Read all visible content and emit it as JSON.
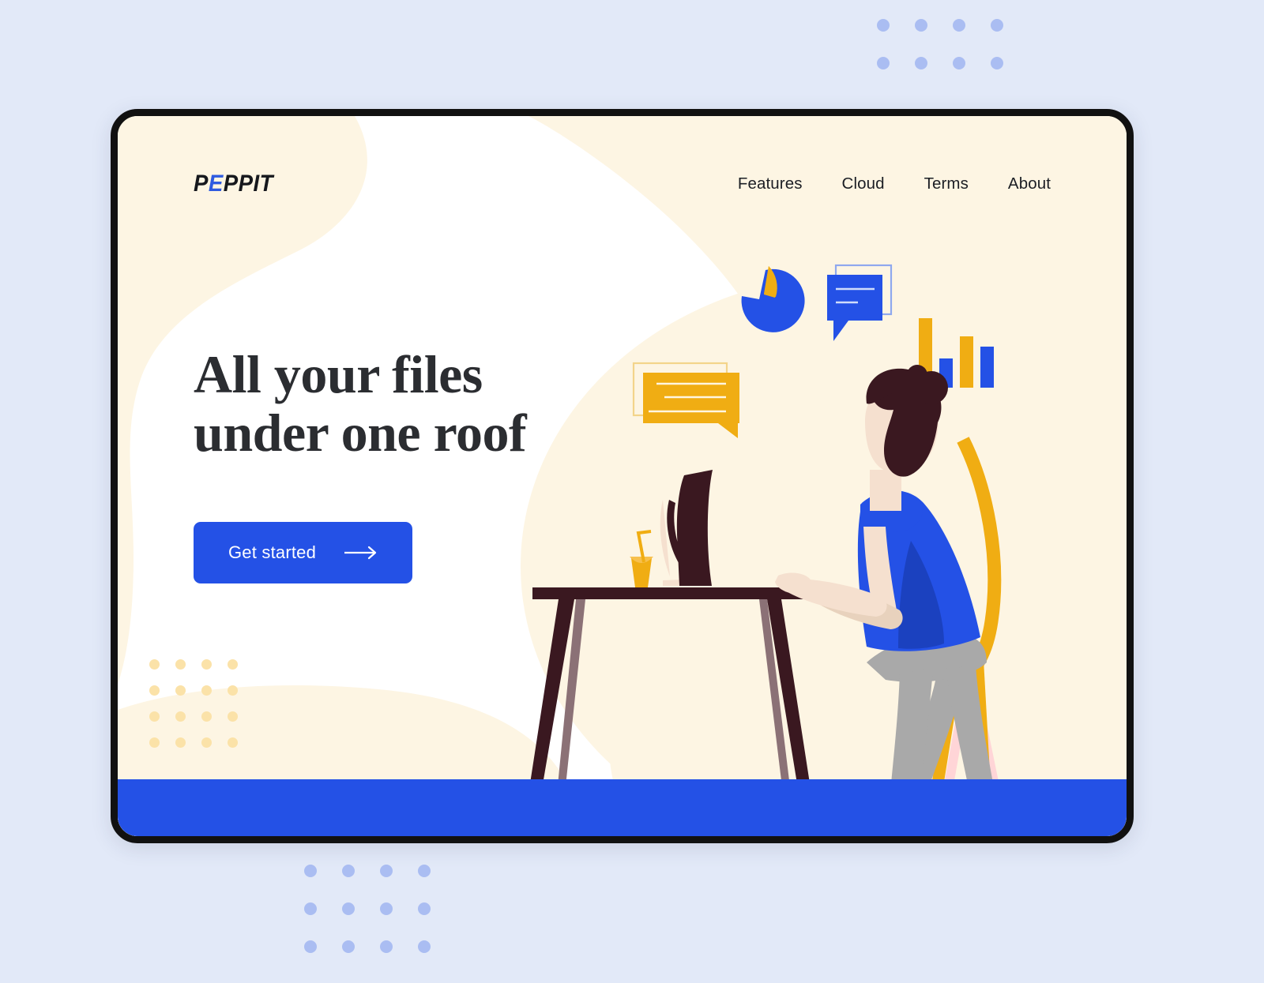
{
  "page": {
    "background_color": "#e2e9f8",
    "card_background": "#fdf5e3",
    "accent_blue": "#2451e6",
    "accent_yellow": "#f0ad13",
    "footer_color": "#2451e6",
    "frame_color": "#111111"
  },
  "brand": {
    "logo_prefix": "P",
    "logo_accent": "E",
    "logo_suffix": "PPIT",
    "logo_full": "PEPPIT",
    "accent_letter_color": "#2f5be0"
  },
  "nav": {
    "items": [
      {
        "label": "Features"
      },
      {
        "label": "Cloud"
      },
      {
        "label": "Terms"
      },
      {
        "label": "About"
      }
    ]
  },
  "hero": {
    "headline_line1": "All your files",
    "headline_line2": "under one roof",
    "cta_label": "Get started",
    "cta_icon": "arrow-right-icon",
    "cta_bg": "#2451e6",
    "cta_text_color": "#ffffff"
  },
  "decor": {
    "inner_dot_grid": {
      "rows": 4,
      "cols": 4,
      "color": "#fbe2a8",
      "spacing": 33,
      "radius": 6.5
    },
    "outer_dot_grid_top_right": {
      "rows": 3,
      "cols": 4,
      "color": "#aabdf2",
      "spacing": 48,
      "radius": 8
    },
    "outer_dot_grid_bottom_left": {
      "rows": 3,
      "cols": 4,
      "color": "#aabdf2",
      "spacing": 48,
      "radius": 8
    }
  },
  "illustration": {
    "name": "woman-working-at-desk",
    "pie_chart": {
      "type": "pie",
      "slices": [
        {
          "label": "blue",
          "value": 75,
          "color": "#2451e6"
        },
        {
          "label": "yellow",
          "value": 25,
          "color": "#f0ad13"
        }
      ]
    },
    "bar_chart": {
      "type": "bar",
      "bars": [
        {
          "value": 100,
          "color": "#f0ad13"
        },
        {
          "value": 42,
          "color": "#2451e6"
        },
        {
          "value": 73,
          "color": "#f0ad13"
        },
        {
          "value": 58,
          "color": "#2451e6"
        }
      ]
    },
    "blue_chat_bubble": {
      "lines": 2,
      "fill": "#2451e6",
      "outline": "#8fa8ee"
    },
    "yellow_chat_bubble": {
      "lines": 3,
      "fill": "#f0ad13",
      "outline": "#f3d48a"
    },
    "colors": {
      "skin": "#f5e0cf",
      "skin_shadow": "#e8d2bd",
      "hair": "#3a1820",
      "shirt": "#2451e6",
      "shirt_shadow": "#1b41bf",
      "pants": "#a9a9a9",
      "chair": "#f0ad13",
      "chair_accent": "#ffd5d7",
      "desk": "#3a1820",
      "desk_leg_light": "#8b7176",
      "monitor": "#3a1820",
      "drink": "#f0ad13",
      "shoes": "#3a1820"
    }
  }
}
